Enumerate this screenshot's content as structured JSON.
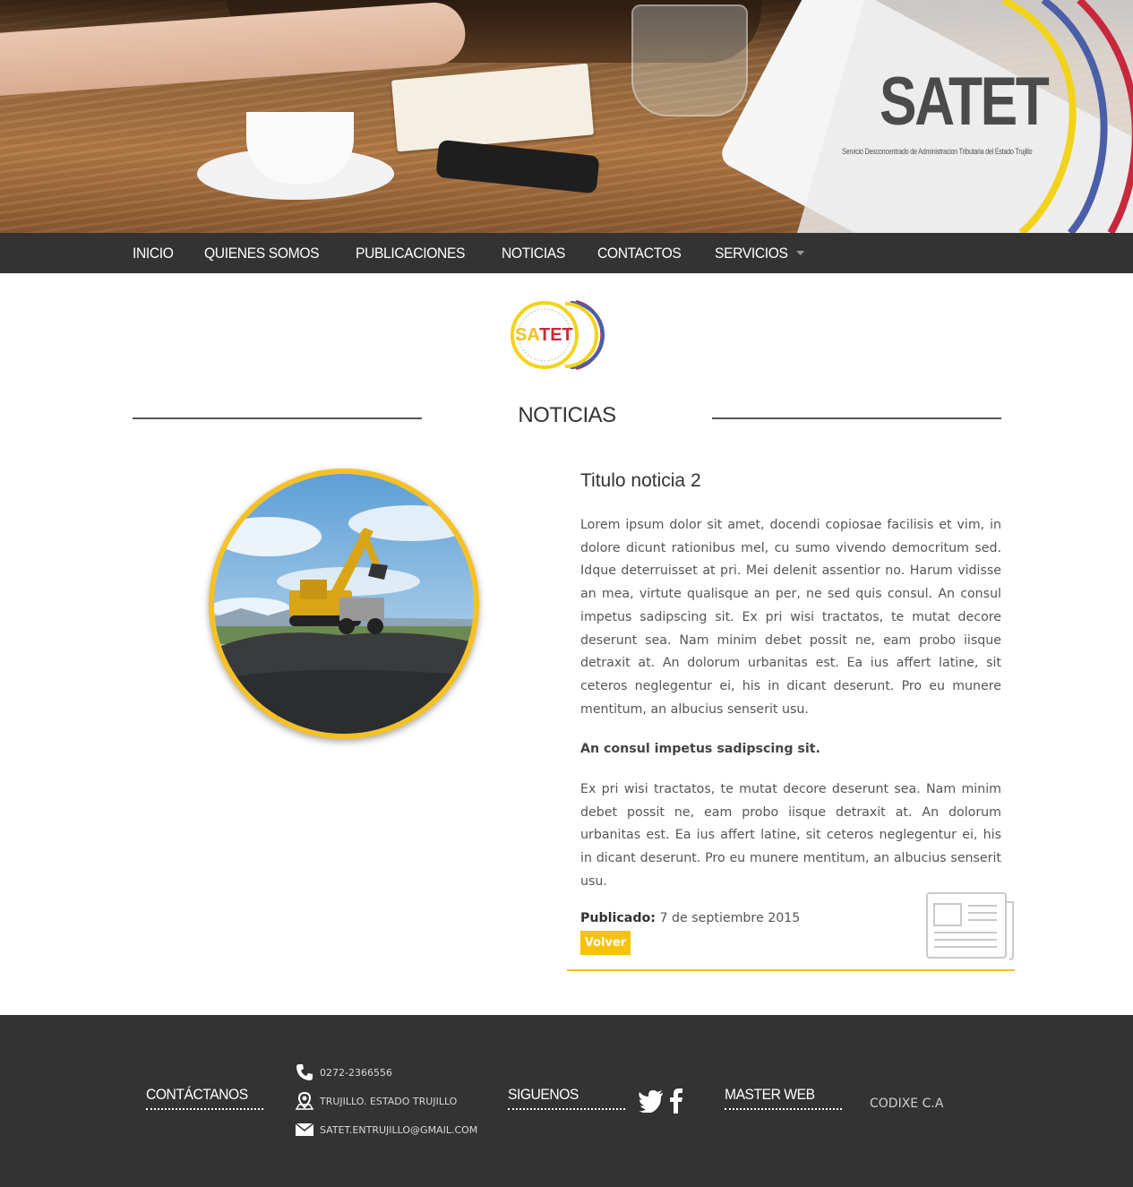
{
  "header": {
    "brand": "SATET",
    "brand_subtitle": "Servicio Desconcentrado de Administracion Tributaria del Estado Trujillo"
  },
  "nav": {
    "items": [
      {
        "label": "INICIO"
      },
      {
        "label": "QUIENES SOMOS"
      },
      {
        "label": "PUBLICACIONES"
      },
      {
        "label": "NOTICIAS"
      },
      {
        "label": "CONTACTOS"
      },
      {
        "label": "SERVICIOS",
        "has_dropdown": true
      }
    ]
  },
  "logo": {
    "text_sa": "SA",
    "text_tet": "TET"
  },
  "section": {
    "title": "NOTICIAS"
  },
  "news": {
    "title": "Titulo noticia 2",
    "paragraph1": "Lorem ipsum dolor sit amet, docendi copiosae facilisis et vim, in dolore dicunt rationibus mel, cu sumo vivendo democritum sed. Idque deterruisset at pri. Mei delenit assentior no. Harum vidisse an mea, virtute qualisque an per, ne sed quis consul. An consul impetus sadipscing sit. Ex pri wisi tractatos, te mutat decore deserunt sea. Nam minim debet possit ne, eam probo iisque detraxit at. An dolorum urbanitas est. Ea ius affert latine, sit ceteros neglegentur ei, his in dicant deserunt. Pro eu munere mentitum, an albucius senserit usu.",
    "subheading": "An consul impetus sadipscing sit.",
    "paragraph2": "Ex pri wisi tractatos, te mutat decore deserunt sea. Nam minim debet possit ne, eam probo iisque detraxit at. An dolorum urbanitas est. Ea ius affert latine, sit ceteros neglegentur ei, his in dicant deserunt. Pro eu munere mentitum, an albucius senserit usu.",
    "published_label": "Publicado:",
    "published_date": "7 de septiembre 2015",
    "back_button": "Volver"
  },
  "footer": {
    "contact_title": "CONTÁCTANOS",
    "phone": "0272-2366556",
    "address": "TRUJILLO. ESTADO TRUJILLO",
    "email": "SATET.ENTRUJILLO@GMAIL.COM",
    "follow_title": "SIGUENOS",
    "master_title": "MASTER WEB",
    "master_name": "CODIXE C.A"
  },
  "colors": {
    "accent_yellow": "#f6c124",
    "nav_bg": "#333333",
    "footer_bg": "#333333",
    "flag_blue": "#4a5fa8",
    "flag_red": "#c8283c"
  },
  "icons": [
    "phone-icon",
    "map-pin-icon",
    "envelope-icon",
    "twitter-icon",
    "facebook-icon",
    "newspaper-icon",
    "dropdown-caret-icon"
  ]
}
